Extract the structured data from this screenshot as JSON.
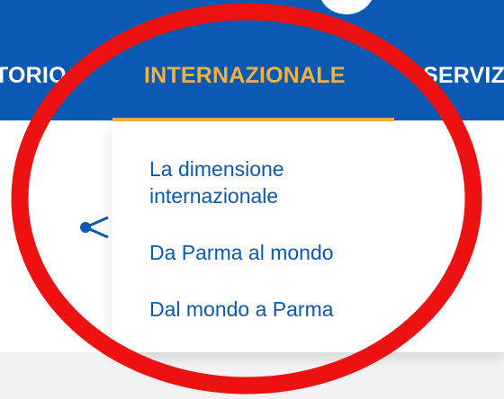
{
  "nav": {
    "items": [
      {
        "label": "TORIO"
      },
      {
        "label": "INTERNAZIONALE"
      },
      {
        "label": "SERVIZ"
      }
    ],
    "active_index": 1
  },
  "dropdown": {
    "items": [
      {
        "label": "La dimensione internazionale"
      },
      {
        "label": "Da Parma al mondo"
      },
      {
        "label": "Dal mondo a Parma"
      }
    ]
  },
  "colors": {
    "header_bg": "#0a59b2",
    "active_accent": "#f3b23f",
    "link": "#0a59b2",
    "annotation": "#ee1111"
  },
  "icons": [
    "share-icon"
  ],
  "annotation": {
    "shape": "ellipse",
    "color": "red"
  }
}
